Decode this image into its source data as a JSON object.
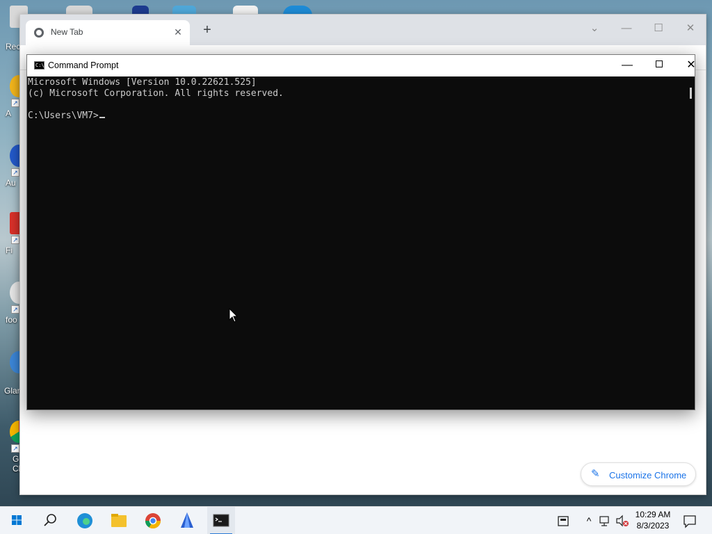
{
  "desktop": {
    "icons": [
      {
        "label": "Rec"
      },
      {
        "label": "A"
      },
      {
        "label": "Au"
      },
      {
        "label": "Fi"
      },
      {
        "label": "foo"
      },
      {
        "label": "Glary"
      },
      {
        "label": "G\nCl"
      }
    ]
  },
  "chrome": {
    "tab_title": "New Tab",
    "tab_close": "✕",
    "new_tab": "+",
    "minimize": "—",
    "restore": "☐",
    "close": "✕",
    "chevron": "⌄",
    "customize_label": "Customize Chrome"
  },
  "cmd": {
    "title": "Command Prompt",
    "icon_text": "C:\\",
    "minimize": "—",
    "close": "✕",
    "lines": [
      "Microsoft Windows [Version 10.0.22621.525]",
      "(c) Microsoft Corporation. All rights reserved.",
      "",
      "C:\\Users\\VM7>"
    ]
  },
  "taskbar": {
    "apps": [
      "start-icon",
      "search-icon",
      "edge-icon",
      "file-explorer-icon",
      "chrome-icon",
      "app-icon",
      "command-prompt-icon"
    ],
    "tray_expand": "^",
    "time": "10:29 AM",
    "date": "8/3/2023"
  },
  "colors": {
    "console_bg": "#0c0c0c",
    "console_fg": "#cccccc",
    "chrome_accent": "#1a73e8",
    "taskbar_bg": "#f1f4f8"
  }
}
